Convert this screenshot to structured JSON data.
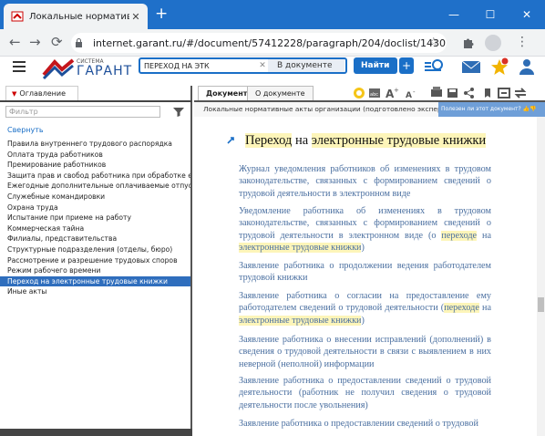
{
  "browser": {
    "tab_title": "Локальные нормативные акты",
    "url": "internet.garant.ru/#/document/57412228/paragraph/204/doclist/14303/showentri...",
    "new_tab_symbol": "+",
    "tab_close_symbol": "✕",
    "min_symbol": "—",
    "max_symbol": "☐",
    "close_symbol": "✕",
    "back_symbol": "←",
    "forward_symbol": "→",
    "reload_symbol": "⟳",
    "star_symbol": "☆",
    "menu_symbol": "⋮"
  },
  "header": {
    "logo_small": "СИСТЕМА",
    "logo_big": "ГАРАНТ",
    "search_value": "ПЕРЕХОД НА ЭТК",
    "clear_symbol": "✕",
    "scope": "В документе",
    "find_label": "Найти",
    "go2_symbol": "+"
  },
  "left": {
    "tab_label": "Оглавление",
    "filter_placeholder": "Фильтр",
    "collapse_label": "Свернуть",
    "items": [
      "Правила внутреннего трудового распорядка",
      "Оплата труда работников",
      "Премирование работников",
      "Защита прав и свобод работника при обработке его п",
      "Ежегодные дополнительные оплачиваемые отпуска",
      "Служебные командировки",
      "Охрана труда",
      "Испытание при приеме на работу",
      "Коммерческая тайна",
      "Филиалы, представительства",
      "Структурные подразделения (отделы, бюро)",
      "Рассмотрение и разрешение трудовых споров",
      "Режим рабочего времени",
      "Переход на электронные трудовые книжки",
      "Иные акты"
    ]
  },
  "right": {
    "tab_document": "Документ",
    "tab_about": "О документе",
    "breadcrumb": "Локальные нормативные акты организации (подготовлено экспертами ...",
    "useful_prompt": "Полезен ли этот документ?",
    "doc_title_a": "Переход",
    "doc_title_b": "на",
    "doc_title_c": "электронные трудовые книжки",
    "p1": "Журнал уведомления работников об изменениях в трудовом законодательстве, связанных с формированием сведений о трудовой деятельности в электронном виде",
    "p2_main": "Уведомление работника об изменениях в трудовом законодательстве, связанных с формированием сведений о трудовой деятельности в электронном виде (о ",
    "p2_hl1": "переходе",
    "p2_mid": " на ",
    "p2_hl2": "электронные трудовые книжки",
    "p2_end": ")",
    "p3": "Заявление работника о продолжении ведения работодателем трудовой книжки",
    "p4_main": "Заявление работника о согласии на предоставление ему работодателем сведений о трудовой деятельности (",
    "p4_hl1": "переходе",
    "p4_mid": " на ",
    "p4_hl2": "электронные трудовые книжки",
    "p4_end": ")",
    "p5": "Заявление работника о внесении исправлений (дополнений) в сведения о трудовой деятельности в связи с выявлением в них неверной (неполной) информации",
    "p6": "Заявление работника о предоставлении сведений о трудовой деятельности (работник не получил сведения о трудовой деятельности после увольнения)",
    "p7": "Заявление работника о предоставлении сведений о трудовой"
  }
}
